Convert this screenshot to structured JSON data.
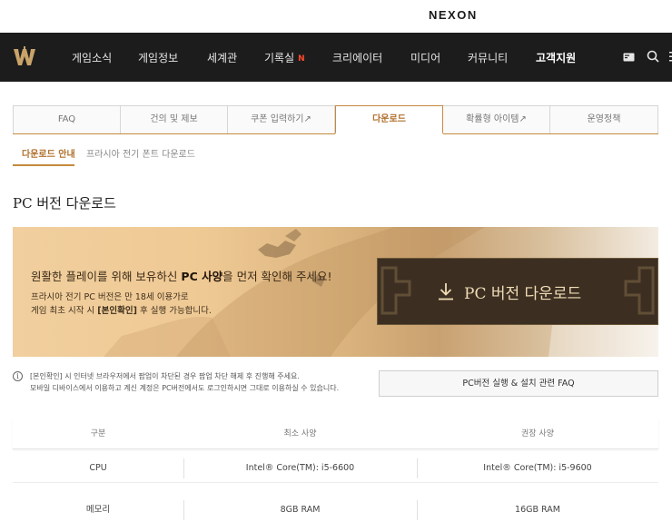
{
  "header": {
    "brand": "NEXON"
  },
  "nav": {
    "items": [
      {
        "label": "게임소식"
      },
      {
        "label": "게임정보"
      },
      {
        "label": "세계관"
      },
      {
        "label": "기록실",
        "badge": "N"
      },
      {
        "label": "크리에이터"
      },
      {
        "label": "미디어"
      },
      {
        "label": "커뮤니티"
      },
      {
        "label": "고객지원",
        "active": true
      }
    ],
    "icons": [
      "menu-card-icon",
      "search-icon",
      "hamburger-menu-icon"
    ]
  },
  "tabs": [
    {
      "label": "FAQ"
    },
    {
      "label": "건의 및 제보"
    },
    {
      "label": "쿠폰 입력하기↗"
    },
    {
      "label": "다운로드",
      "active": true
    },
    {
      "label": "확률형 아이템↗"
    },
    {
      "label": "운영정책"
    }
  ],
  "subtabs": [
    {
      "label": "다운로드 안내",
      "active": true
    },
    {
      "label": "프라시아 전기 폰트 다운로드"
    }
  ],
  "section": {
    "title": "PC 버전 다운로드"
  },
  "banner": {
    "headline_pre": "원활한 플레이를 위해 보유하신 ",
    "headline_bold": "PC 사양",
    "headline_post": "을 먼저 확인해 주세요!",
    "sub_line1": "프라시아 전기 PC 버전은 만 18세 이용가로",
    "sub_line2_pre": "게임 최초 시작 시 ",
    "sub_line2_bold": "[본인확인]",
    "sub_line2_post": " 후 실행 가능합니다.",
    "download_label": "PC 버전 다운로드",
    "accent_color": "#3c2f22"
  },
  "notice": {
    "icon_glyph": "i",
    "line1": "[본인확인] 시 인터넷 브라우저에서 팝업이 차단된 경우 팝업 차단 해제 후 진행해 주세요.",
    "line2": "모바일 디바이스에서 이용하고 계신 계정은 PC버전에서도 로그인하시면 그대로 이용하실 수 있습니다."
  },
  "faq_button": {
    "label": "PC버전 실행 & 설치 관련 FAQ"
  },
  "spec_table": {
    "headers": [
      "구분",
      "최소 사양",
      "권장 사양"
    ],
    "rows": [
      [
        "CPU",
        "Intel® Core(TM): i5-6600",
        "Intel® Core(TM): i5-9600"
      ],
      [
        "메모리",
        "8GB RAM",
        "16GB RAM"
      ]
    ]
  }
}
